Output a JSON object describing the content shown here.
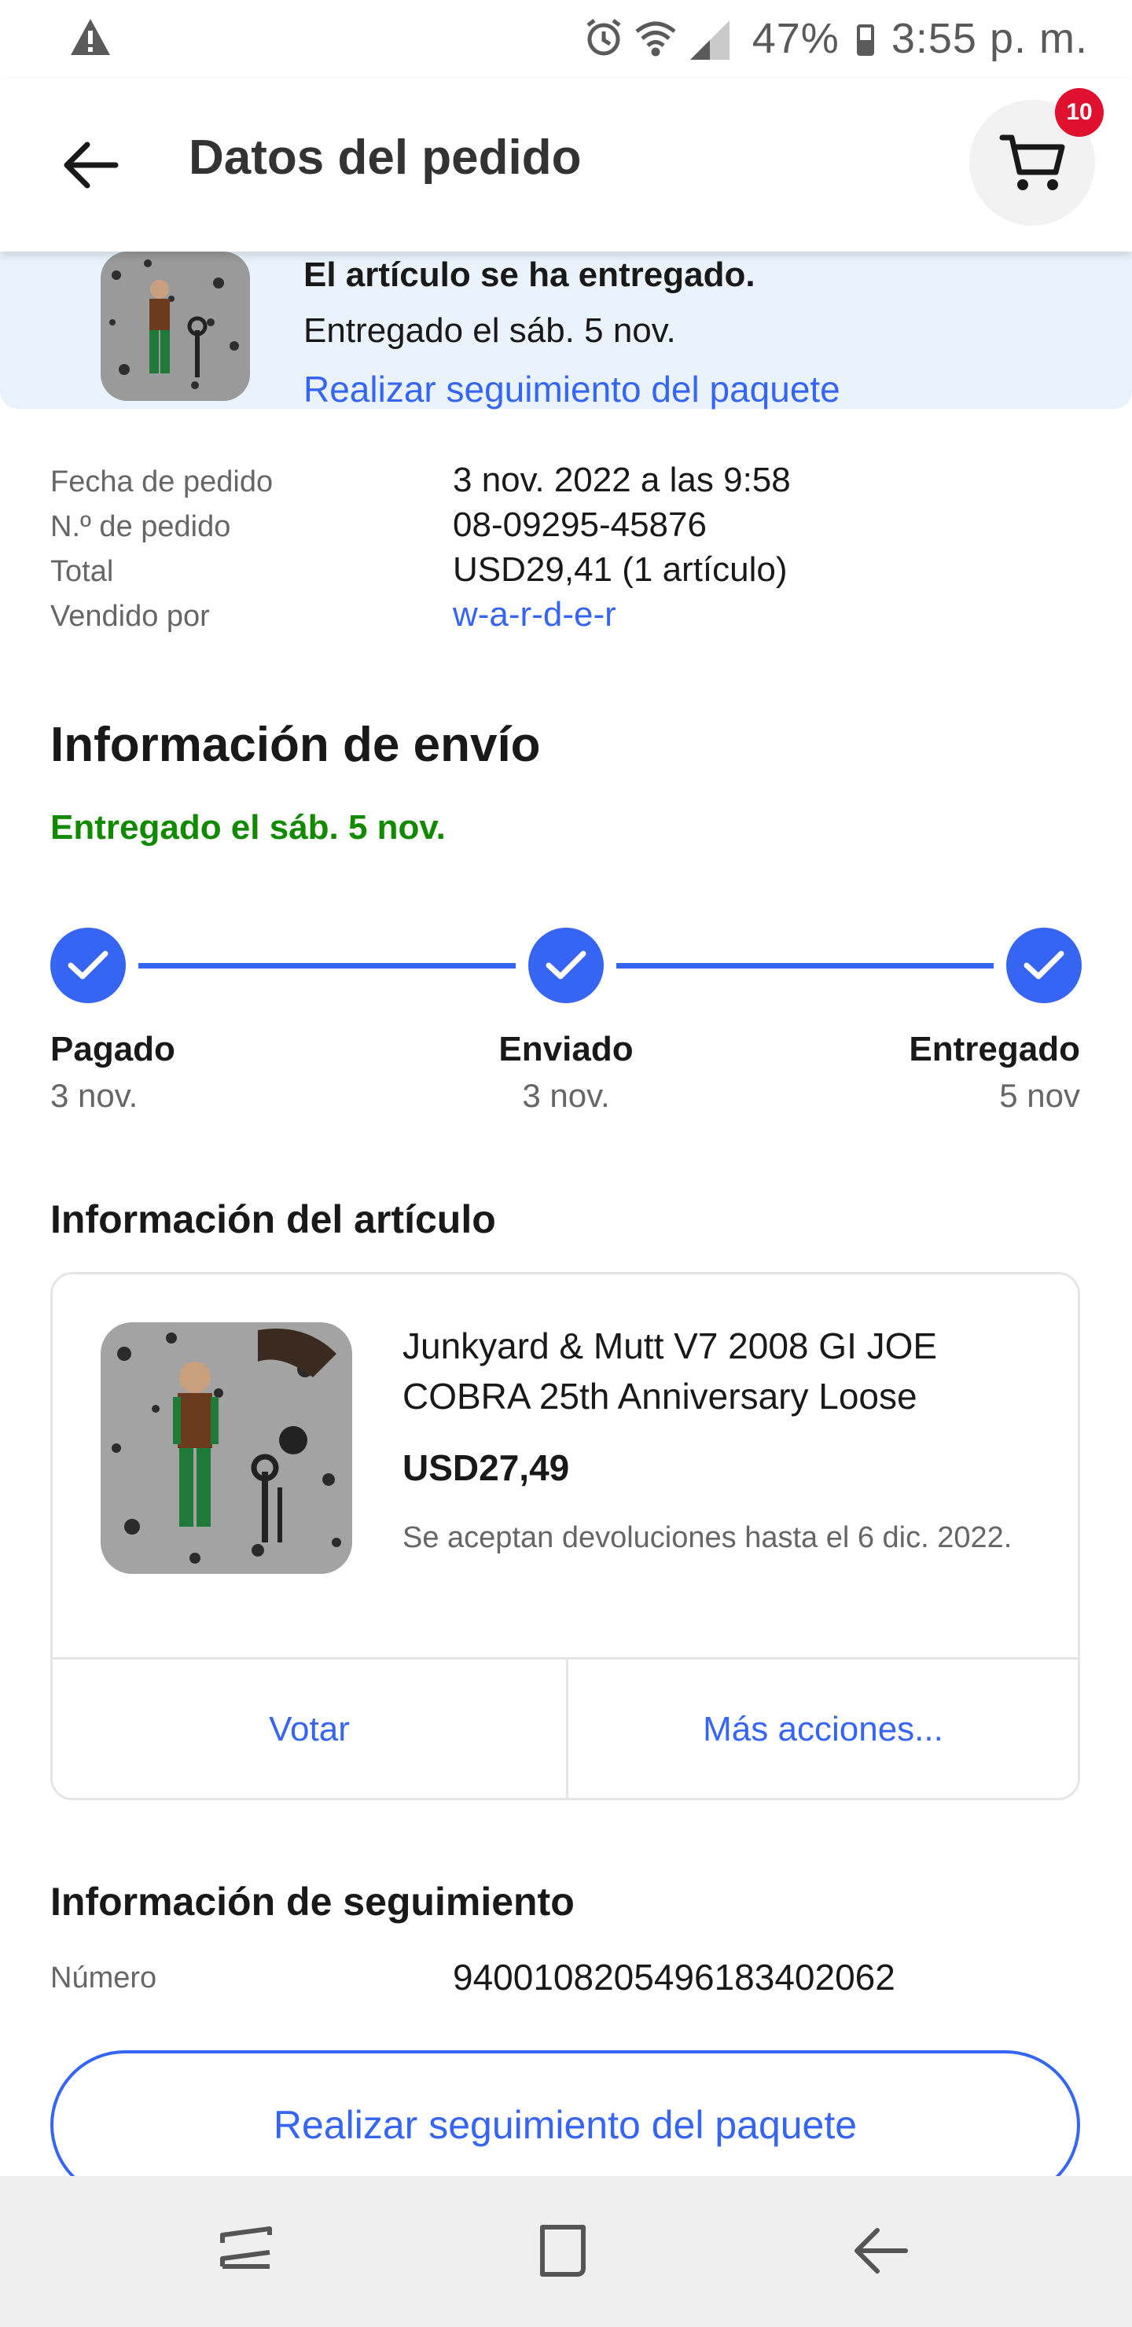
{
  "status_bar": {
    "battery": "47%",
    "time": "3:55 p. m.",
    "icons": [
      "warning-icon",
      "alarm-icon",
      "wifi-icon",
      "signal-icon",
      "battery-icon"
    ]
  },
  "header": {
    "title": "Datos del pedido",
    "cart_count": "10"
  },
  "banner": {
    "status": "El artículo se ha entregado.",
    "delivered_on": "Entregado el sáb. 5 nov.",
    "track_link": "Realizar seguimiento del paquete"
  },
  "order": {
    "rows": [
      {
        "label": "Fecha de pedido",
        "value": "3 nov. 2022 a las 9:58"
      },
      {
        "label": "N.º de pedido",
        "value": "08-09295-45876"
      },
      {
        "label": "Total",
        "value": "USD29,41 (1 artículo)"
      },
      {
        "label": "Vendido por",
        "value": "w-a-r-d-e-r"
      }
    ]
  },
  "shipping": {
    "title": "Información de envío",
    "status": "Entregado el sáb. 5 nov.",
    "steps": [
      {
        "label": "Pagado",
        "date": "3 nov."
      },
      {
        "label": "Enviado",
        "date": "3 nov."
      },
      {
        "label": "Entregado",
        "date": "5 nov"
      }
    ]
  },
  "item": {
    "section_title": "Información del artículo",
    "title": "Junkyard & Mutt V7 2008 GI JOE COBRA 25th Anniversary Loose",
    "price": "USD27,49",
    "returns": "Se aceptan devoluciones hasta el 6 dic. 2022.",
    "action_rate": "Votar",
    "action_more": "Más acciones..."
  },
  "tracking": {
    "section_title": "Información de seguimiento",
    "number_label": "Número",
    "number": "9400108205496183402062",
    "button": "Realizar seguimiento del paquete"
  },
  "colors": {
    "accent": "#3665f3",
    "success": "#118a00",
    "badge": "#e0102f",
    "banner_bg": "#eaf3fc"
  }
}
